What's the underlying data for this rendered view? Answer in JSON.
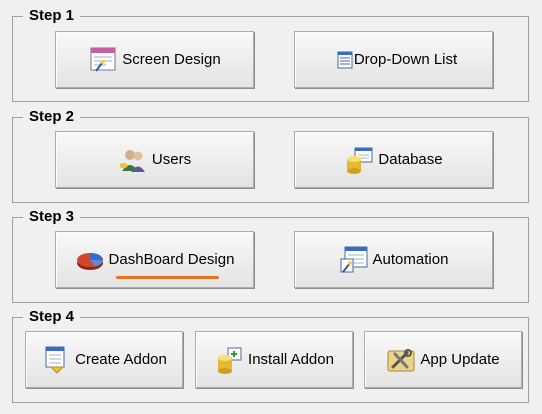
{
  "steps": [
    {
      "title": "Step 1",
      "buttons": [
        {
          "label": "Screen Design",
          "icon": "screen-design-icon"
        },
        {
          "label": "Drop-Down List",
          "icon": "list-icon"
        }
      ]
    },
    {
      "title": "Step 2",
      "buttons": [
        {
          "label": "Users",
          "icon": "users-icon"
        },
        {
          "label": "Database",
          "icon": "database-icon"
        }
      ]
    },
    {
      "title": "Step 3",
      "buttons": [
        {
          "label": "DashBoard Design",
          "icon": "pie-chart-icon"
        },
        {
          "label": "Automation",
          "icon": "automation-icon"
        }
      ]
    },
    {
      "title": "Step 4",
      "buttons": [
        {
          "label": "Create Addon",
          "icon": "create-addon-icon"
        },
        {
          "label": "Install Addon",
          "icon": "install-addon-icon"
        },
        {
          "label": "App Update",
          "icon": "tools-icon"
        }
      ]
    }
  ],
  "colors": {
    "focus_accent": "#e8711f",
    "background": "#f0f0f0"
  }
}
